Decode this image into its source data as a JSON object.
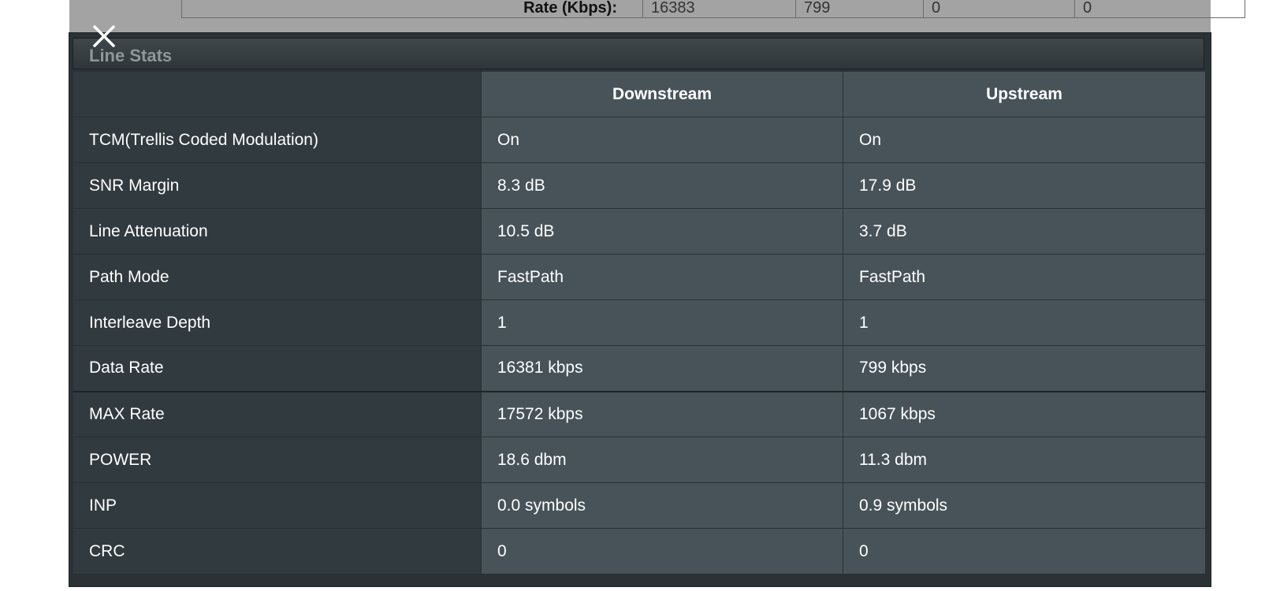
{
  "background": {
    "row_label": "Rate (Kbps):",
    "cells": [
      "16383",
      "799",
      "0",
      "0"
    ]
  },
  "dialog": {
    "title": "Line Stats",
    "close_icon": "close-icon",
    "headers": [
      "",
      "Downstream",
      "Upstream"
    ],
    "rows": [
      {
        "label": "TCM(Trellis Coded Modulation)",
        "downstream": "On",
        "upstream": "On"
      },
      {
        "label": "SNR Margin",
        "downstream": "8.3 dB",
        "upstream": "17.9 dB"
      },
      {
        "label": "Line Attenuation",
        "downstream": "10.5 dB",
        "upstream": "3.7 dB"
      },
      {
        "label": "Path Mode",
        "downstream": "FastPath",
        "upstream": "FastPath"
      },
      {
        "label": "Interleave Depth",
        "downstream": "1",
        "upstream": "1"
      },
      {
        "label": "Data Rate",
        "downstream": "16381 kbps",
        "upstream": "799 kbps"
      },
      {
        "label": "MAX Rate",
        "downstream": "17572 kbps",
        "upstream": "1067 kbps"
      },
      {
        "label": "POWER",
        "downstream": "18.6 dbm",
        "upstream": "11.3 dbm"
      },
      {
        "label": "INP",
        "downstream": "0.0 symbols",
        "upstream": "0.9 symbols"
      },
      {
        "label": "CRC",
        "downstream": "0",
        "upstream": "0"
      }
    ]
  },
  "colors": {
    "dialog_bg": "#2b3236",
    "label_cell": "#313a3e",
    "value_cell": "#475359",
    "text": "#ffffff"
  }
}
